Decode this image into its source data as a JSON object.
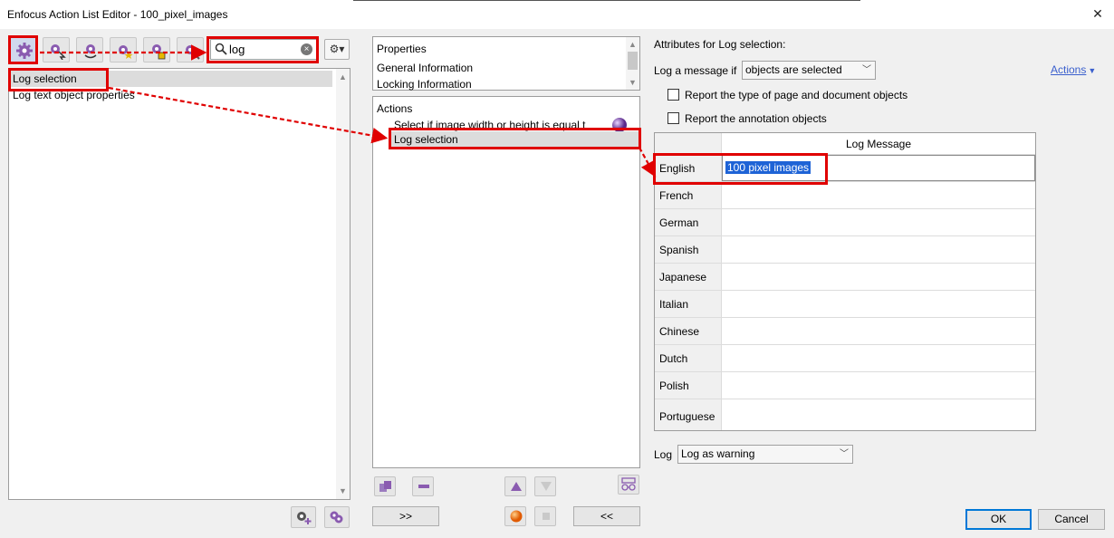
{
  "window": {
    "title": "Enfocus Action List Editor - 100_pixel_images",
    "close_glyph": "✕"
  },
  "toolbar": {
    "buttons": [
      {
        "name": "actions-library-button",
        "icon": "gear-icon"
      },
      {
        "name": "edit-action-button",
        "icon": "gear-cursor-icon"
      },
      {
        "name": "undo-action-button",
        "icon": "gear-undo-icon"
      },
      {
        "name": "favorite-action-button",
        "icon": "gear-star-icon"
      },
      {
        "name": "import-action-button",
        "icon": "gear-import-icon"
      },
      {
        "name": "tools-action-button",
        "icon": "gear-wrench-icon"
      }
    ],
    "search": {
      "value": "log",
      "clear_glyph": "×"
    },
    "options_glyph": "⚙▾"
  },
  "left_list": {
    "items": [
      "Log selection",
      "Log text object properties"
    ]
  },
  "properties_panel": {
    "header": "Properties",
    "items": [
      "General Information",
      "Locking Information"
    ]
  },
  "actions_panel": {
    "header": "Actions",
    "items": [
      "Select if image width or height is equal t",
      "Log selection"
    ]
  },
  "bottom_buttons": {
    "add_right": ">>",
    "add_left": "<<"
  },
  "attributes": {
    "title": "Attributes for Log selection:",
    "log_if_label": "Log a message if",
    "log_if_value": "objects are selected",
    "actions_link": "Actions",
    "check_type_label": "Report the type of page and document objects",
    "check_annot_label": "Report the annotation objects",
    "table_header": "Log Message",
    "rows": [
      {
        "lang": "English",
        "msg": "100 pixel images"
      },
      {
        "lang": "French",
        "msg": ""
      },
      {
        "lang": "German",
        "msg": ""
      },
      {
        "lang": "Spanish",
        "msg": ""
      },
      {
        "lang": "Japanese",
        "msg": ""
      },
      {
        "lang": "Italian",
        "msg": ""
      },
      {
        "lang": "Chinese",
        "msg": ""
      },
      {
        "lang": "Dutch",
        "msg": ""
      },
      {
        "lang": "Polish",
        "msg": ""
      },
      {
        "lang": "Portuguese",
        "msg": ""
      }
    ],
    "log_label": "Log",
    "log_value": "Log as warning"
  },
  "dialog": {
    "ok_label": "OK",
    "cancel_label": "Cancel"
  },
  "colors": {
    "annotation_red": "#e00000",
    "selection_blue": "#1e63d6",
    "gear_purple": "#8a5bb0"
  }
}
